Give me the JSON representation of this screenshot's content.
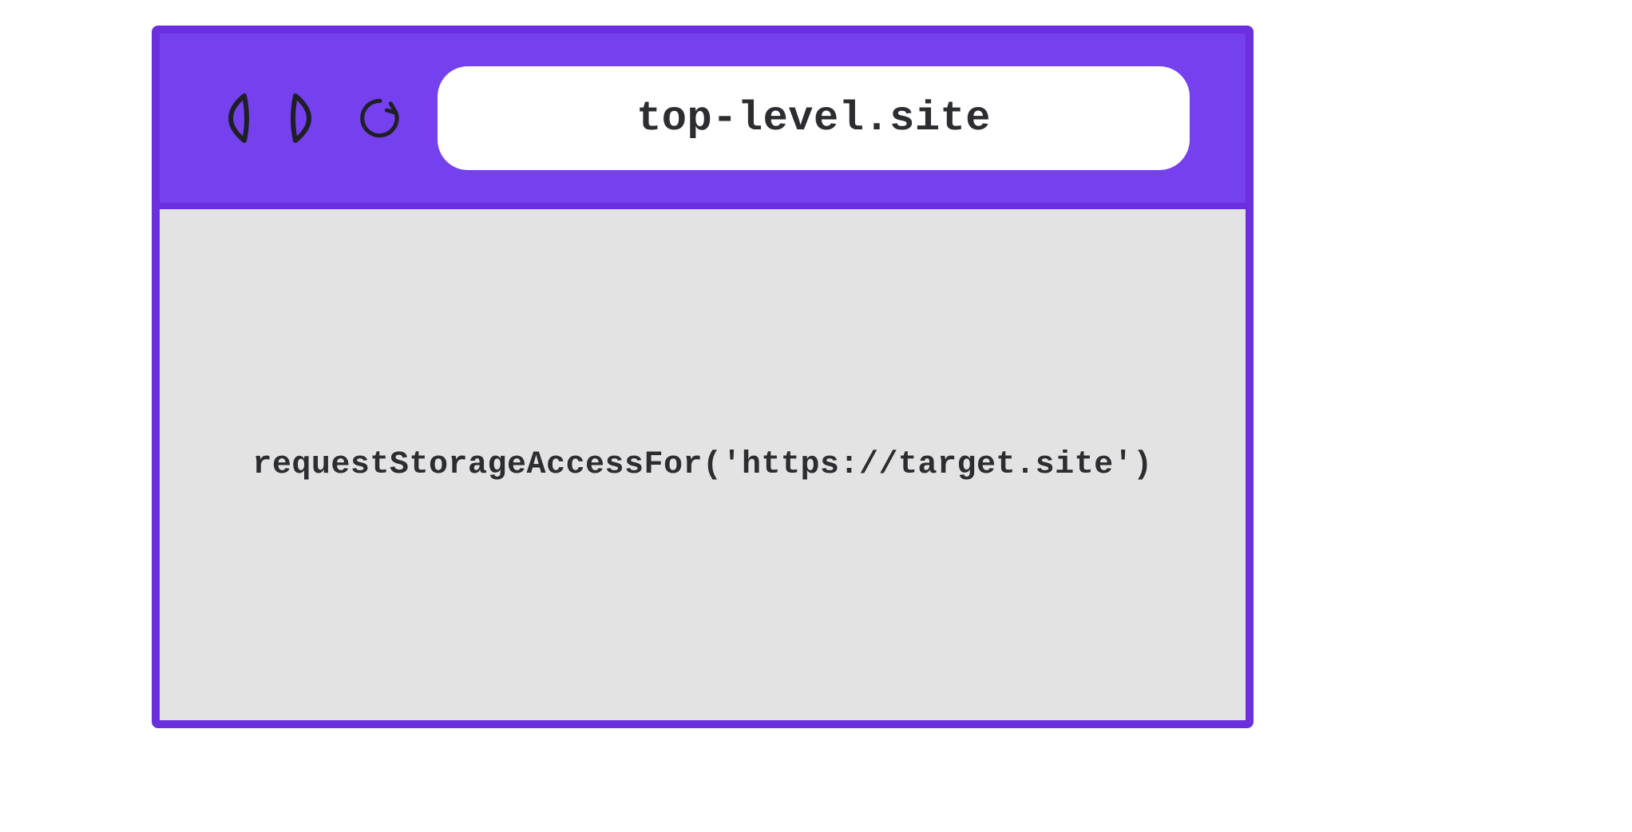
{
  "browser": {
    "address": "top-level.site",
    "code_snippet": "requestStorageAccessFor('https://target.site')"
  },
  "colors": {
    "frame_border": "#6b2fdd",
    "toolbar_bg": "#7540ee",
    "viewport_bg": "#e3e3e3",
    "icon_stroke": "#1f2023",
    "text": "#2b2d31"
  }
}
